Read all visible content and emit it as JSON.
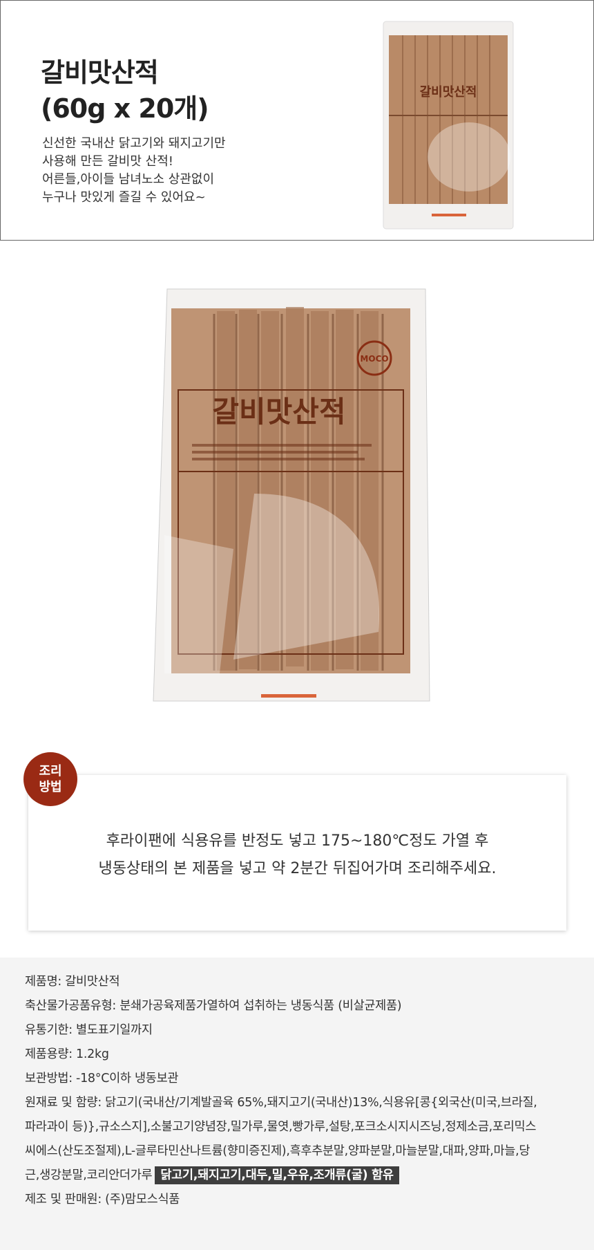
{
  "header": {
    "title_line1": "갈비맛산적",
    "title_line2": "(60g x 20개)",
    "desc": [
      "신선한 국내산 닭고기와 돼지고기만",
      "사용해 만든 갈비맛 산적!",
      "어른들,아이들 남녀노소 상관없이",
      "누구나 맛있게 즐길 수 있어요~"
    ]
  },
  "package": {
    "label": "갈비맛산적",
    "logo": "MOCO"
  },
  "cooking": {
    "badge_line1": "조리",
    "badge_line2": "방법",
    "lines": [
      "후라이팬에 식용유를 반정도 넣고 175~180℃정도 가열 후",
      "냉동상태의 본 제품을 넣고 약 2분간 뒤집어가며 조리해주세요."
    ]
  },
  "info": {
    "name": "제품명: 갈비맛산적",
    "type": "축산물가공품유형: 분쇄가공육제품가열하여 섭취하는 냉동식품 (비살균제품)",
    "expiry": "유통기한: 별도표기일까지",
    "volume": "제품용량: 1.2kg",
    "storage": "보관방법: -18°C이하 냉동보관",
    "ingredients": [
      "원재료 및 함량: 닭고기(국내산/기계발골육 65%,돼지고기(국내산)13%,식용유[콩{외국산(미국,브라질,",
      "파라과이 등)},규소스지],소불고기양념장,밀가루,물엿,빵가루,설탕,포크소시지시즈닝,정제소금,포리믹스",
      "씨에스(산도조절제),L-글루타민산나트륨(향미증진제),흑후추분말,양파분말,마늘분말,대파,양파,마늘,당",
      "근,생강분말,코리안더가루"
    ],
    "allergen": "닭고기,돼지고기,대두,밀,우유,조개류(굴) 함유",
    "manufacturer": "제조 및 판매원: (주)맘모스식품"
  }
}
